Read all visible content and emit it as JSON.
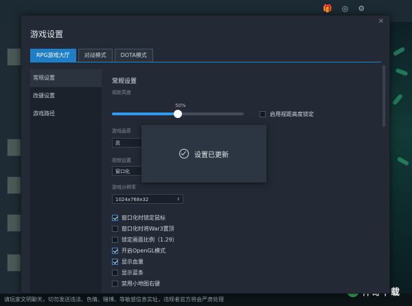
{
  "dialog": {
    "title": "游戏设置",
    "tabs": [
      {
        "label": "RPG游戏大厅",
        "active": true
      },
      {
        "label": "对战模式",
        "active": false
      },
      {
        "label": "DOTA模式",
        "active": false
      }
    ],
    "sidebar": [
      {
        "label": "常规设置",
        "active": true
      },
      {
        "label": "改键设置",
        "active": false
      },
      {
        "label": "游戏路径",
        "active": false
      }
    ]
  },
  "settings": {
    "section_title": "常规设置",
    "view_height_label": "视距高度",
    "view_height_value": "50%",
    "view_height_fraction": 0.5,
    "lock_view_label": "启用视距高度锁定",
    "display_mode_label": "游戏画质",
    "display_mode_value": "高",
    "window_label": "视频设置",
    "window_value": "窗口化",
    "resolution_label": "游戏分辨率",
    "resolution_value": "1024x768x32",
    "options": [
      {
        "label": "窗口化时锁定鼠标",
        "checked": true
      },
      {
        "label": "窗口化时将War3置顶",
        "checked": false
      },
      {
        "label": "锁定画面比例（1.29）",
        "checked": false
      },
      {
        "label": "开启OpenGL模式",
        "checked": true
      },
      {
        "label": "显示血量",
        "checked": true
      },
      {
        "label": "显示蓝条",
        "checked": false
      },
      {
        "label": "禁用小地图右键",
        "checked": false
      }
    ]
  },
  "toast": {
    "message": "设置已更新"
  },
  "footer": {
    "notice": "请玩家文明聊天，切勿发送违法、色情、赌博、等敏感信息实址，违规者官方将会严肃处理"
  },
  "brand": {
    "text": "神奇下载"
  }
}
